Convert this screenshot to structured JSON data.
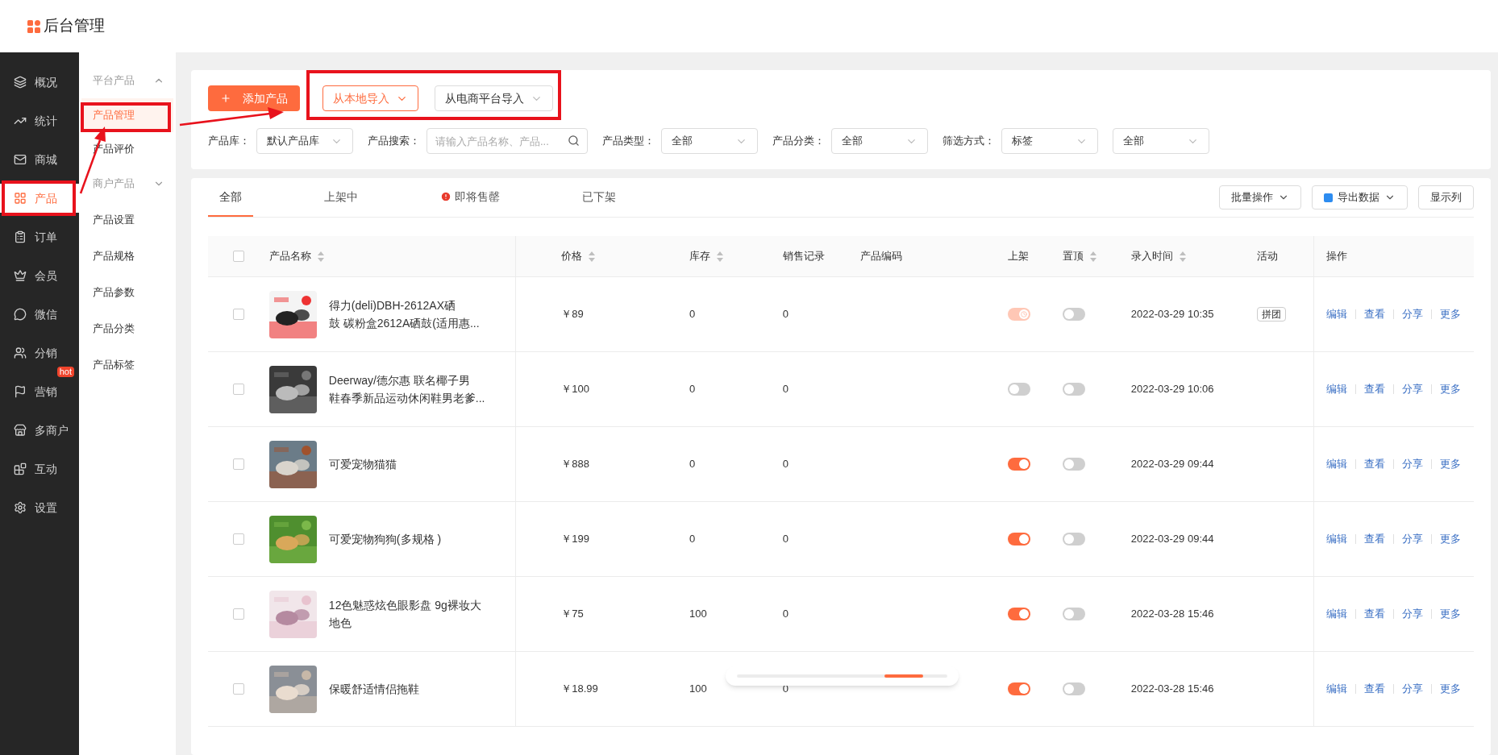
{
  "header": {
    "title": "后台管理"
  },
  "main_nav": [
    {
      "label": "概况",
      "selected": false
    },
    {
      "label": "统计",
      "selected": false
    },
    {
      "label": "商城",
      "selected": false
    },
    {
      "label": "产品",
      "selected": true
    },
    {
      "label": "订单",
      "selected": false
    },
    {
      "label": "会员",
      "selected": false
    },
    {
      "label": "微信",
      "selected": false
    },
    {
      "label": "分销",
      "selected": false
    },
    {
      "label": "营销",
      "selected": false,
      "badge": "hot"
    },
    {
      "label": "多商户",
      "selected": false
    },
    {
      "label": "互动",
      "selected": false
    },
    {
      "label": "设置",
      "selected": false
    }
  ],
  "sub_nav": [
    {
      "kind": "group",
      "label": "平台产品",
      "expanded": true,
      "children": [
        {
          "label": "产品管理",
          "selected": true
        },
        {
          "label": "产品评价",
          "selected": false
        }
      ]
    },
    {
      "kind": "group",
      "label": "商户产品",
      "expanded": false
    },
    {
      "kind": "item",
      "label": "产品设置",
      "selected": false
    },
    {
      "kind": "item",
      "label": "产品规格",
      "selected": false
    },
    {
      "kind": "item",
      "label": "产品参数",
      "selected": false
    },
    {
      "kind": "item",
      "label": "产品分类",
      "selected": false
    },
    {
      "kind": "item",
      "label": "产品标签",
      "selected": false
    }
  ],
  "toolbar": {
    "add_button": "添加产品",
    "import_buttons": [
      {
        "label": "从本地导入",
        "selected": true
      },
      {
        "label": "从电商平台导入",
        "selected": false
      }
    ]
  },
  "filters": [
    {
      "kind": "select",
      "label": "产品库：",
      "value": "默认产品库"
    },
    {
      "kind": "search",
      "label": "产品搜索：",
      "placeholder": "请输入产品名称、产品..."
    },
    {
      "kind": "select",
      "label": "产品类型：",
      "value": "全部"
    },
    {
      "kind": "select",
      "label": "产品分类：",
      "value": "全部"
    },
    {
      "kind": "select",
      "label": "筛选方式：",
      "value": "标签"
    },
    {
      "kind": "select",
      "value": "全部"
    }
  ],
  "tabs": [
    {
      "label": "全部",
      "selected": true,
      "warning": false
    },
    {
      "label": "上架中",
      "selected": false,
      "warning": false
    },
    {
      "label": "即将售罄",
      "selected": false,
      "warning": true
    },
    {
      "label": "已下架",
      "selected": false,
      "warning": false
    }
  ],
  "actions": [
    {
      "label": "批量操作",
      "kind": "dropdown"
    },
    {
      "label": "导出数据",
      "kind": "export"
    },
    {
      "label": "显示列",
      "kind": "plain"
    }
  ],
  "table": {
    "header_checked": false,
    "columns": [
      {
        "label": "产品名称",
        "sortable": true
      },
      {
        "label": "价格",
        "sortable": true
      },
      {
        "label": "库存",
        "sortable": true
      },
      {
        "label": "销售记录",
        "sortable": false
      },
      {
        "label": "产品编码",
        "sortable": false
      },
      {
        "label": "上架",
        "sortable": false
      },
      {
        "label": "置顶",
        "sortable": true
      },
      {
        "label": "录入时间",
        "sortable": true
      },
      {
        "label": "活动",
        "sortable": false
      },
      {
        "label": "操作",
        "sortable": false
      }
    ],
    "rows": [
      {
        "checked": false,
        "image": {
          "kind": "picture"
        },
        "name": [
          "得力(deli)DBH-2612AX硒",
          "鼓 碳粉盒2612A硒鼓(适用惠..."
        ],
        "price": "￥89",
        "stock": "0",
        "sales": "0",
        "listed": true,
        "listed_disabled": true,
        "pinned": false,
        "time": "2022-03-29 10:35",
        "activity": "拼团",
        "ops": [
          "编辑",
          "查看",
          "分享",
          "更多"
        ]
      },
      {
        "checked": false,
        "image": {
          "kind": "picture"
        },
        "name": [
          "Deerway/德尔惠 联名椰子男",
          "鞋春季新品运动休闲鞋男老爹..."
        ],
        "price": "￥100",
        "stock": "0",
        "sales": "0",
        "listed": false,
        "listed_disabled": false,
        "pinned": false,
        "time": "2022-03-29 10:06",
        "ops": [
          "编辑",
          "查看",
          "分享",
          "更多"
        ]
      },
      {
        "checked": false,
        "image": {
          "kind": "picture"
        },
        "name": [
          "可爱宠物猫猫"
        ],
        "price": "￥888",
        "stock": "0",
        "sales": "0",
        "listed": true,
        "listed_disabled": false,
        "pinned": false,
        "time": "2022-03-29 09:44",
        "ops": [
          "编辑",
          "查看",
          "分享",
          "更多"
        ]
      },
      {
        "checked": false,
        "image": {
          "kind": "picture"
        },
        "name": [
          "可爱宠物狗狗(多规格 )"
        ],
        "price": "￥199",
        "stock": "0",
        "sales": "0",
        "listed": true,
        "listed_disabled": false,
        "pinned": false,
        "time": "2022-03-29 09:44",
        "ops": [
          "编辑",
          "查看",
          "分享",
          "更多"
        ]
      },
      {
        "checked": false,
        "image": {
          "kind": "picture"
        },
        "name": [
          "12色魅惑炫色眼影盘 9g裸妆大",
          "地色"
        ],
        "price": "￥75",
        "stock": "100",
        "sales": "0",
        "listed": true,
        "listed_disabled": false,
        "pinned": false,
        "time": "2022-03-28 15:46",
        "ops": [
          "编辑",
          "查看",
          "分享",
          "更多"
        ]
      },
      {
        "checked": false,
        "image": {
          "kind": "picture"
        },
        "name": [
          "保暖舒适情侣拖鞋"
        ],
        "price": "￥18.99",
        "stock": "100",
        "sales": "0",
        "listed": true,
        "listed_disabled": false,
        "pinned": false,
        "time": "2022-03-28 15:46",
        "ops": [
          "编辑",
          "查看",
          "分享",
          "更多"
        ]
      }
    ]
  }
}
